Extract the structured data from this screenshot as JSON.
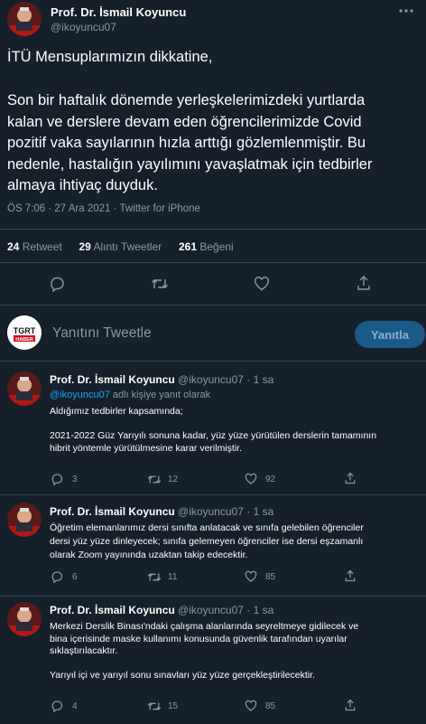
{
  "main_tweet": {
    "author_name": "Prof. Dr. İsmail Koyuncu",
    "handle": "@ikoyuncu07",
    "line1": "İTÜ Mensuplarımızın dikkatine,",
    "body_lines": [
      "Son bir haftalık dönemde yerleşkelerimizdeki yurtlarda",
      "kalan ve derslere devam eden öğrencilerimizde Covid",
      "pozitif vaka sayılarının hızla arttığı gözlemlenmiştir. Bu",
      "nedenle, hastalığın yayılımını yavaşlatmak için tedbirler",
      "almaya ihtiyaç duyduk."
    ],
    "meta": "ÖS 7:06 · 27 Ara 2021 · Twitter for iPhone",
    "stats": {
      "retweets": "24",
      "retweets_label": "Retweet",
      "quotes": "29",
      "quotes_label": "Alıntı Tweetler",
      "likes": "261",
      "likes_label": "Beğeni"
    },
    "more_icon": "more-horizontal-icon"
  },
  "compose": {
    "avatar_text_top": "TGRT",
    "avatar_text_bottom": "HABER",
    "placeholder": "Yanıtını Tweetle",
    "button_label": "Yanıtla"
  },
  "replies": [
    {
      "author_name": "Prof. Dr. İsmail Koyuncu",
      "handle": "@ikoyuncu07",
      "time": "· 1 sa",
      "reply_to_handle": "@ikoyuncu07",
      "reply_to_suffix": "adlı kişiye yanıt olarak",
      "lines": [
        "Aldığımız tedbirler kapsamında;",
        "",
        "2021-2022 Güz Yarıyılı sonuna kadar, yüz yüze yürütülen derslerin tamamının",
        "hibrit yöntemle yürütülmesine karar verilmiştir."
      ],
      "counts": {
        "replies": "3",
        "retweets": "12",
        "likes": "92"
      }
    },
    {
      "author_name": "Prof. Dr. İsmail Koyuncu",
      "handle": "@ikoyuncu07",
      "time": "· 1 sa",
      "lines": [
        "Öğretim elemanlarımız dersi sınıfta anlatacak ve sınıfa gelebilen öğrenciler",
        "dersi yüz yüze dinleyecek; sınıfa gelemeyen öğrenciler ise dersi eşzamanlı",
        "olarak Zoom yayınında uzaktan takip edecektir."
      ],
      "counts": {
        "replies": "6",
        "retweets": "11",
        "likes": "85"
      }
    },
    {
      "author_name": "Prof. Dr. İsmail Koyuncu",
      "handle": "@ikoyuncu07",
      "time": "· 1 sa",
      "lines": [
        "Merkezi Derslik Binası'ndaki çalışma alanlarında seyreltmeye gidilecek ve",
        "bina içerisinde maske kullanımı konusunda güvenlik tarafından uyarılar",
        "sıklaştırılacaktır.",
        "",
        "Yarıyıl içi ve yarıyıl sonu sınavları yüz yüze gerçekleştirilecektir."
      ],
      "counts": {
        "replies": "4",
        "retweets": "15",
        "likes": "85"
      }
    }
  ],
  "colors": {
    "background": "#15202b",
    "text": "#ffffff",
    "muted": "#8899a6",
    "link": "#1da1f2",
    "divider": "#38444d",
    "reply_button": "#1a5a86"
  }
}
